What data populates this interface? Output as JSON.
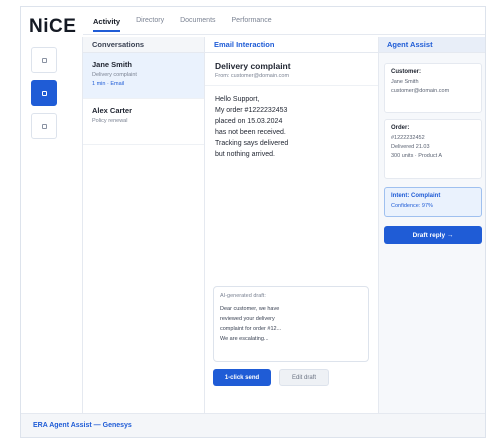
{
  "app": {
    "logo": "NiCE"
  },
  "tabs": [
    {
      "label": "Activity",
      "active": true
    },
    {
      "label": "Directory",
      "active": false
    },
    {
      "label": "Documents",
      "active": false
    },
    {
      "label": "Performance",
      "active": false
    }
  ],
  "rail": {
    "items": [
      {
        "icon": "square-icon"
      },
      {
        "icon": "square-icon",
        "active": true
      },
      {
        "icon": "square-icon"
      }
    ]
  },
  "conversations": {
    "heading": "Conversations",
    "items": [
      {
        "name": "Jane Smith",
        "subject": "Delivery complaint",
        "meta": "1 min · Email"
      },
      {
        "name": "Alex Carter",
        "subject": "Policy renewal",
        "meta": ""
      }
    ]
  },
  "email": {
    "heading": "Email Interaction",
    "subject": "Delivery complaint",
    "from": "From: customer@domain.com",
    "body": [
      "Hello Support,",
      "My order #1222232453",
      "placed on 15.03.2024",
      "has not been received.",
      "Tracking says delivered",
      "but nothing arrived."
    ],
    "draft": {
      "label": "AI-generated draft:",
      "lines": [
        "Dear customer, we have",
        "reviewed your delivery",
        "complaint for order #12...",
        "We are escalating..."
      ]
    },
    "send_label": "1-click send",
    "edit_label": "Edit draft"
  },
  "assist": {
    "heading": "Agent Assist",
    "customer": {
      "title": "Customer:",
      "lines": [
        "Jane Smith",
        "customer@domain.com"
      ]
    },
    "order": {
      "title": "Order:",
      "lines": [
        "#1222232452",
        "Delivered 21.03",
        "300 units · Product A"
      ]
    },
    "intent": {
      "title": "Intent: Complaint",
      "confidence": "Confidence: 97%"
    },
    "draft_button": "Draft reply  →"
  },
  "footer": {
    "text": "ERA Agent Assist — Genesys"
  },
  "colors": {
    "accent": "#1f5cd6",
    "selected_bg": "#eaf2fd"
  }
}
